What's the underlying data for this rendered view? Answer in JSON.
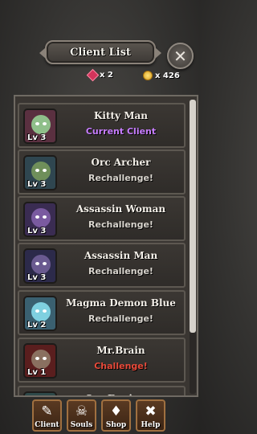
{
  "header": {
    "title": "Client List",
    "close_icon": "close-icon"
  },
  "currency": {
    "gems": "x 2",
    "coins": "x 426",
    "gem_color": "#d4345b",
    "coin_color": "#f2c14e"
  },
  "clients": [
    {
      "name": "Kitty Man",
      "level": "Lv 3",
      "status": "Current Client",
      "status_color": "#c77dff",
      "portrait_bg": "#5a3040",
      "face": "#8fbf8a"
    },
    {
      "name": "Orc Archer",
      "level": "Lv 3",
      "status": "Rechallenge!",
      "status_color": "#d9d5ce",
      "portrait_bg": "#2f4650",
      "face": "#6f8f5a"
    },
    {
      "name": "Assassin Woman",
      "level": "Lv 3",
      "status": "Rechallenge!",
      "status_color": "#d9d5ce",
      "portrait_bg": "#3a2c52",
      "face": "#7a5aa0"
    },
    {
      "name": "Assassin Man",
      "level": "Lv 3",
      "status": "Rechallenge!",
      "status_color": "#d9d5ce",
      "portrait_bg": "#2c2a4a",
      "face": "#6a5a90"
    },
    {
      "name": "Magma Demon Blue",
      "level": "Lv 2",
      "status": "Rechallenge!",
      "status_color": "#d9d5ce",
      "portrait_bg": "#3a6070",
      "face": "#7fd0e0"
    },
    {
      "name": "Mr.Brain",
      "level": "Lv 1",
      "status": "Challenge!",
      "status_color": "#e84a3a",
      "portrait_bg": "#5a1e1e",
      "face": "#8a7060"
    },
    {
      "name": "Orc Engineer",
      "level": "",
      "status": "",
      "status_color": "#d9d5ce",
      "portrait_bg": "#2f4a4a",
      "face": "#6f8f5a"
    }
  ],
  "nav": [
    {
      "label": "Client",
      "icon": "scroll-icon",
      "glyph": "✎"
    },
    {
      "label": "Souls",
      "icon": "skull-icon",
      "glyph": "☠"
    },
    {
      "label": "Shop",
      "icon": "gem-icon",
      "glyph": "♦"
    },
    {
      "label": "Help",
      "icon": "help-icon",
      "glyph": "✖"
    }
  ]
}
